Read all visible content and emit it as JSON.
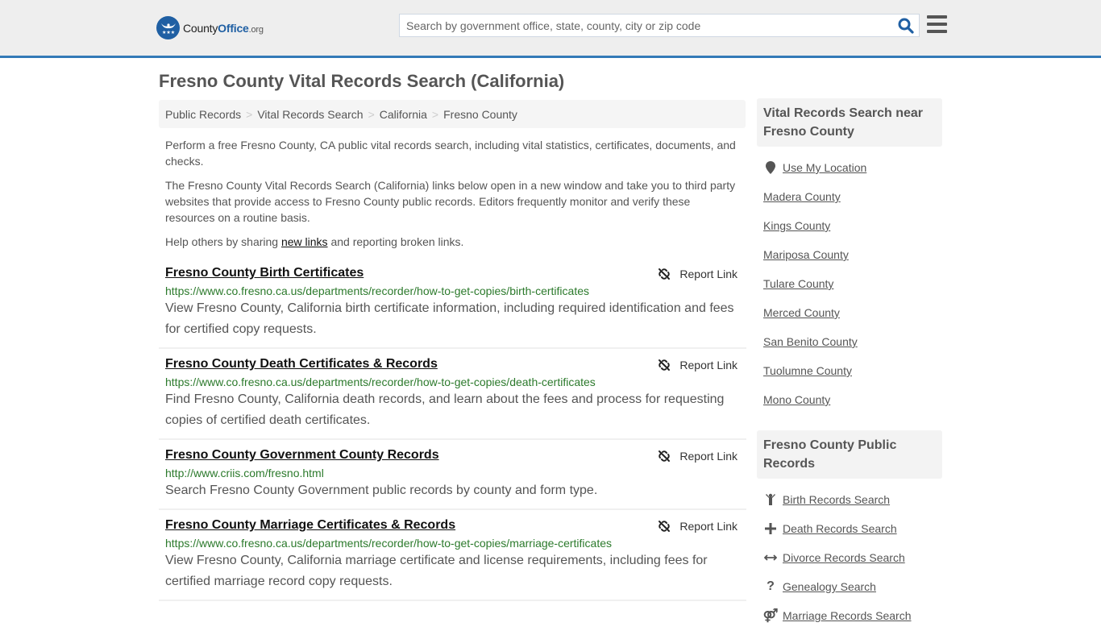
{
  "header": {
    "logo": {
      "name_part1": "County",
      "name_part2": "Office",
      "tld": ".org"
    },
    "search": {
      "placeholder": "Search by government office, state, county, city or zip code",
      "value": ""
    },
    "colors": {
      "accent": "#337ab7",
      "brand": "#1f5fa3"
    }
  },
  "page": {
    "title": "Fresno County Vital Records Search (California)"
  },
  "breadcrumb": [
    {
      "label": "Public Records"
    },
    {
      "label": "Vital Records Search"
    },
    {
      "label": "California"
    },
    {
      "label": "Fresno County"
    }
  ],
  "breadcrumb_separator": ">",
  "intro": {
    "p1": "Perform a free Fresno County, CA public vital records search, including vital statistics, certificates, documents, and checks.",
    "p2": "The Fresno County Vital Records Search (California) links below open in a new window and take you to third party websites that provide access to Fresno County public records. Editors frequently monitor and verify these resources on a routine basis.",
    "p3_before": "Help others by sharing ",
    "p3_link": "new links",
    "p3_after": " and reporting broken links."
  },
  "results": [
    {
      "title": "Fresno County Birth Certificates",
      "url": "https://www.co.fresno.ca.us/departments/recorder/how-to-get-copies/birth-certificates",
      "description": "View Fresno County, California birth certificate information, including required identification and fees for certified copy requests.",
      "report_label": "Report Link"
    },
    {
      "title": "Fresno County Death Certificates & Records",
      "url": "https://www.co.fresno.ca.us/departments/recorder/how-to-get-copies/death-certificates",
      "description": "Find Fresno County, California death records, and learn about the fees and process for requesting copies of certified death certificates.",
      "report_label": "Report Link"
    },
    {
      "title": "Fresno County Government County Records",
      "url": "http://www.criis.com/fresno.html",
      "description": "Search Fresno County Government public records by county and form type.",
      "report_label": "Report Link"
    },
    {
      "title": "Fresno County Marriage Certificates & Records",
      "url": "https://www.co.fresno.ca.us/departments/recorder/how-to-get-copies/marriage-certificates",
      "description": "View Fresno County, California marriage certificate and license requirements, including fees for certified marriage record copy requests.",
      "report_label": "Report Link"
    }
  ],
  "sidebar": {
    "nearby": {
      "heading": "Vital Records Search near Fresno County",
      "use_location": {
        "label": "Use My Location",
        "icon": "map-marker-icon"
      },
      "counties": [
        "Madera County",
        "Kings County",
        "Mariposa County",
        "Tulare County",
        "Merced County",
        "San Benito County",
        "Tuolumne County",
        "Mono County"
      ]
    },
    "public_records": {
      "heading": "Fresno County Public Records",
      "items": [
        {
          "label": "Birth Records Search",
          "icon": "child-icon"
        },
        {
          "label": "Death Records Search",
          "icon": "plus-icon"
        },
        {
          "label": "Divorce Records Search",
          "icon": "arrows-horizontal-icon"
        },
        {
          "label": "Genealogy Search",
          "icon": "question-icon"
        },
        {
          "label": "Marriage Records Search",
          "icon": "gender-symbol-icon"
        }
      ]
    }
  }
}
